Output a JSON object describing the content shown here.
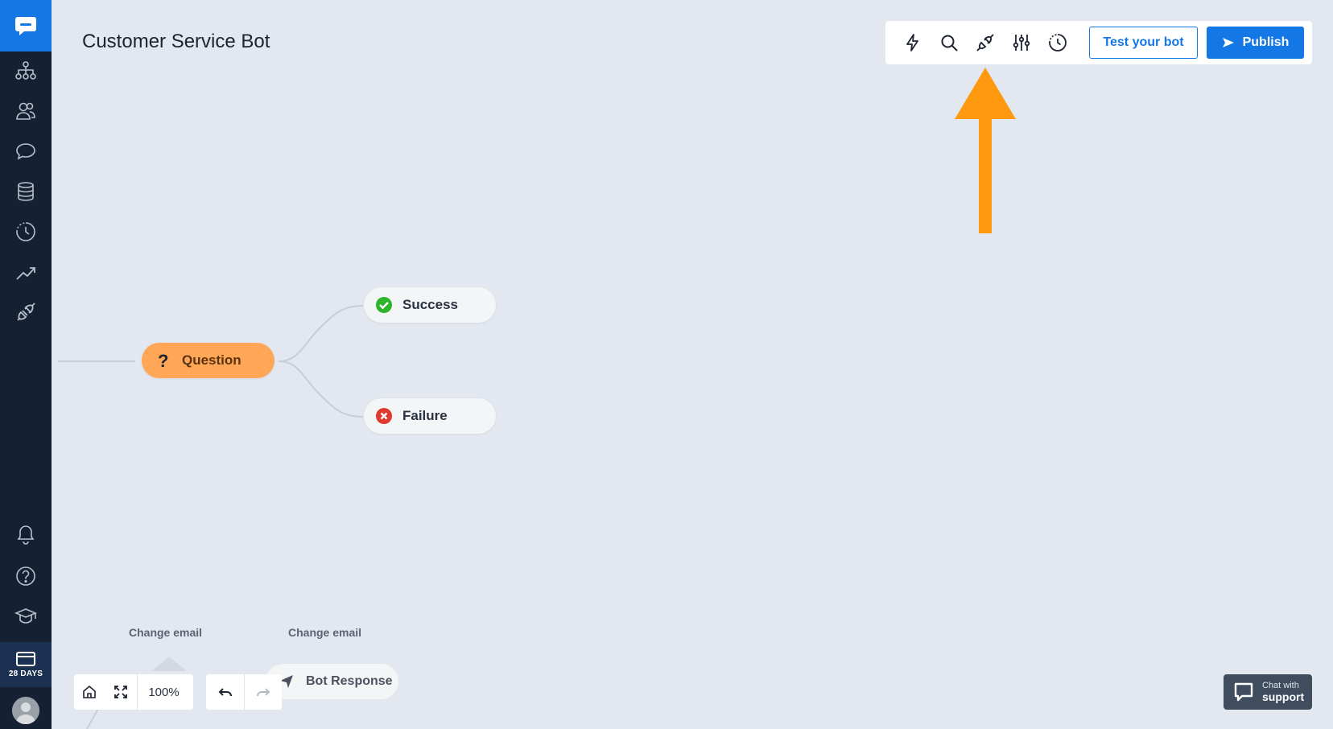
{
  "header": {
    "title": "Customer Service Bot"
  },
  "toolbar": {
    "icons": [
      "lightning-icon",
      "search-icon",
      "plug-icon",
      "sliders-icon",
      "history-icon"
    ],
    "test_label": "Test your bot",
    "publish_label": "Publish"
  },
  "sidebar": {
    "items": [
      "stories-icon",
      "audience-icon",
      "chat-icon",
      "data-icon",
      "training-icon",
      "reports-icon",
      "integrations-icon"
    ],
    "bottom_items": [
      "notifications-icon",
      "help-icon",
      "academy-icon"
    ],
    "trial": {
      "days_label": "28 DAYS"
    }
  },
  "canvas": {
    "question_label": "Question",
    "success_label": "Success",
    "failure_label": "Failure",
    "change_email_1": "Change email",
    "change_email_2": "Change email",
    "bot_response_label": "Bot Response"
  },
  "controls": {
    "zoom_level": "100%"
  },
  "support": {
    "line1": "Chat with",
    "line2": "support"
  },
  "colors": {
    "accent": "#1477e6",
    "sidebar": "#152032",
    "question_node": "#ffa657",
    "arrow": "#ff9a10",
    "success": "#2cb52c",
    "failure": "#e0392e"
  }
}
